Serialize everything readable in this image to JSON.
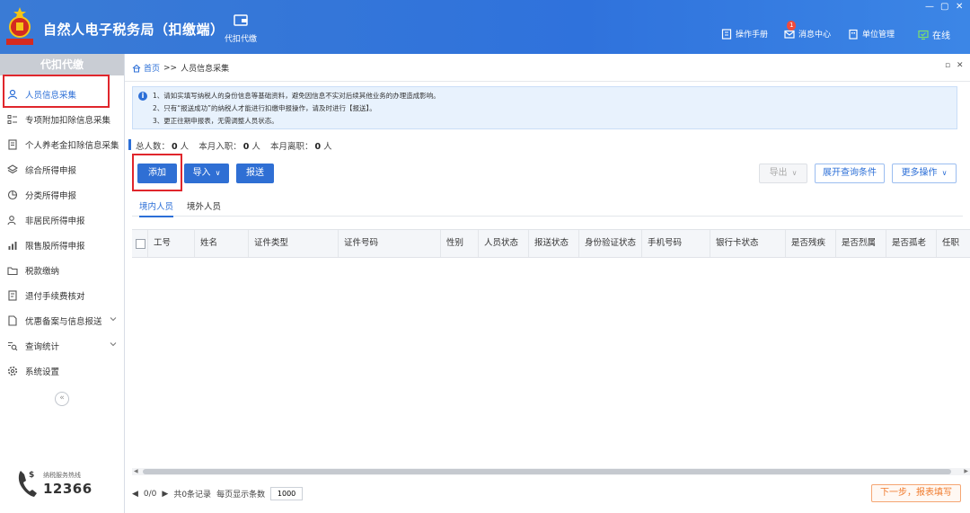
{
  "header": {
    "emblem_text": "中国税务",
    "app_title": "自然人电子税务局（扣缴端）",
    "module_label": "代扣代缴",
    "tools": [
      {
        "icon": "book-icon",
        "label": "操作手册"
      },
      {
        "icon": "mail-icon",
        "label": "消息中心",
        "badge": "1"
      },
      {
        "icon": "building-icon",
        "label": "单位管理"
      },
      {
        "icon": "monitor-check-icon",
        "label": "在线"
      }
    ],
    "window_controls": [
      "—",
      "▢",
      "✕"
    ]
  },
  "sidebar": {
    "title": "代扣代缴",
    "items": [
      {
        "label": "人员信息采集",
        "icon": "person-icon",
        "active": true
      },
      {
        "label": "专项附加扣除信息采集",
        "icon": "list-icon"
      },
      {
        "label": "个人养老金扣除信息采集",
        "icon": "document-icon"
      },
      {
        "label": "综合所得申报",
        "icon": "layers-icon"
      },
      {
        "label": "分类所得申报",
        "icon": "pie-icon"
      },
      {
        "label": "非居民所得申报",
        "icon": "person-outline-icon"
      },
      {
        "label": "限售股所得申报",
        "icon": "bar-chart-icon"
      },
      {
        "label": "税款缴纳",
        "icon": "folder-icon"
      },
      {
        "label": "退付手续费核对",
        "icon": "receipt-icon"
      },
      {
        "label": "优惠备案与信息报送",
        "icon": "file-icon",
        "has_chevron": true
      },
      {
        "label": "查询统计",
        "icon": "search-list-icon",
        "has_chevron": true
      },
      {
        "label": "系统设置",
        "icon": "gear-icon"
      }
    ],
    "collapse_glyph": "«",
    "hotline_label": "纳税服务热线",
    "hotline_number": "12366"
  },
  "breadcrumb": {
    "home": "首页",
    "separator": ">>",
    "current": "人员信息采集"
  },
  "notice": {
    "lines": [
      "1、请如实填写纳税人的身份信息等基础资料，避免因信息不实对后续其他业务的办理造成影响。",
      "2、只有“报送成功”的纳税人才能进行扣缴申报操作，请及时进行【报送】。",
      "3、更正往期申报表，无需调整人员状态。"
    ]
  },
  "stats": {
    "total_label": "总人数：",
    "total_value": "0",
    "joined_label": "本月入职：",
    "joined_value": "0",
    "left_label": "本月离职：",
    "left_value": "0",
    "unit": "人"
  },
  "toolbar": {
    "add": "添加",
    "import": "导入",
    "submit": "报送",
    "export": "导出",
    "expand_query": "展开查询条件",
    "more_ops": "更多操作",
    "dropdown_glyph": "∨"
  },
  "tabs": [
    {
      "label": "境内人员",
      "active": true
    },
    {
      "label": "境外人员"
    }
  ],
  "table": {
    "columns": [
      "工号",
      "姓名",
      "证件类型",
      "证件号码",
      "性别",
      "人员状态",
      "报送状态",
      "身份验证状态",
      "手机号码",
      "银行卡状态",
      "是否残疾",
      "是否烈属",
      "是否孤老",
      "任职"
    ],
    "rows": []
  },
  "pager": {
    "prev_glyph": "◀",
    "page": "0/0",
    "next_glyph": "▶",
    "summary": "共0条记录",
    "page_size_label": "每页显示条数",
    "page_size": "1000"
  },
  "next_step": "下一步，报表填写",
  "colors": {
    "brand_blue": "#2f72dc",
    "highlight_red": "#e0262c",
    "next_orange": "#f07a2c"
  }
}
